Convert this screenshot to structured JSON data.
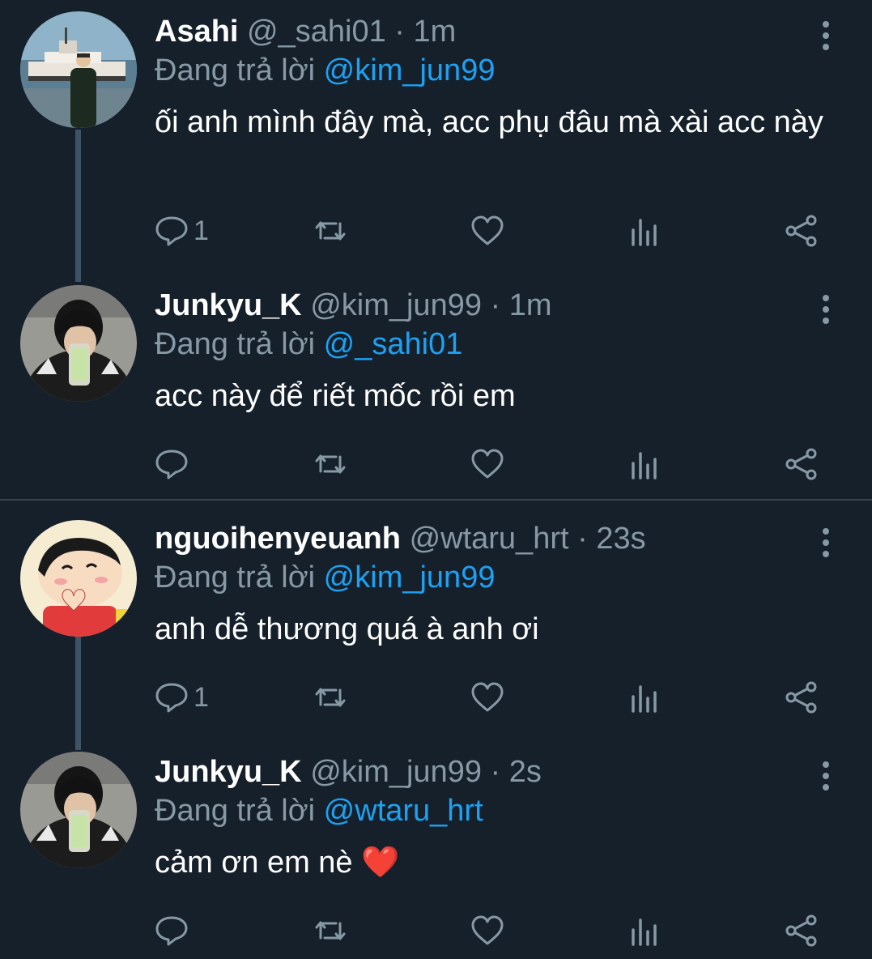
{
  "tweets": [
    {
      "name": "Asahi",
      "handle": "@_sahi01",
      "time": "· 1m",
      "replying_prefix": "Đang trả lời",
      "replying_to": "@kim_jun99",
      "text": "ối anh mình đây mà, acc phụ đâu mà xài acc này",
      "reply_count": "1"
    },
    {
      "name": "Junkyu_K",
      "handle": "@kim_jun99",
      "time": "· 1m",
      "replying_prefix": "Đang trả lời",
      "replying_to": "@_sahi01",
      "text": "acc này để riết mốc rồi em",
      "reply_count": ""
    },
    {
      "name": "nguoihenyeuanh",
      "handle": "@wtaru_hrt",
      "time": "· 23s",
      "replying_prefix": "Đang trả lời",
      "replying_to": "@kim_jun99",
      "text": "anh dễ thương quá à anh ơi",
      "reply_count": "1"
    },
    {
      "name": "Junkyu_K",
      "handle": "@kim_jun99",
      "time": "· 2s",
      "replying_prefix": "Đang trả lời",
      "replying_to": "@wtaru_hrt",
      "text": "cảm ơn em nè",
      "reply_count": ""
    }
  ],
  "emoji": "❤️",
  "colors": {
    "background": "#15202b",
    "secondary_text": "#8899a6",
    "link": "#1da1f2",
    "thread_line": "#3d5466"
  },
  "icons": [
    "reply-icon",
    "retweet-icon",
    "like-icon",
    "analytics-icon",
    "share-icon",
    "more-icon"
  ]
}
